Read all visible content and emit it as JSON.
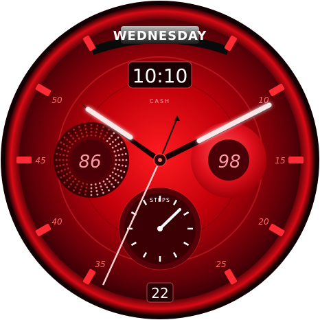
{
  "watch": {
    "day": "WEDNESDAY",
    "time": "10:10",
    "brand": "CASH",
    "date": "22",
    "left_subdial_value": "86",
    "right_subdial_value": "98",
    "steps_label": "STEPS",
    "bezel_numbers": [
      "10",
      "15",
      "20",
      "25",
      "35",
      "40",
      "45",
      "50"
    ]
  },
  "colors": {
    "accent": "#ff2a2a",
    "dial_dark": "#3a0006",
    "dial_mid": "#b0000c",
    "hand_glow": "#ffd0d0",
    "text_light": "#ffffff",
    "number_red": "#ff6a6a"
  },
  "icons": [
    "crown-icon"
  ]
}
